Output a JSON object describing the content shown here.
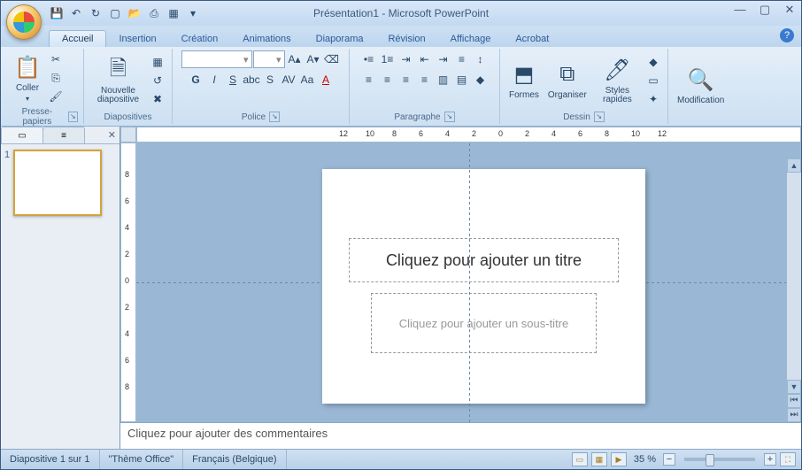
{
  "title": "Présentation1 - Microsoft PowerPoint",
  "tabs": [
    "Accueil",
    "Insertion",
    "Création",
    "Animations",
    "Diaporama",
    "Révision",
    "Affichage",
    "Acrobat"
  ],
  "active_tab": 0,
  "groups": {
    "clipboard": {
      "label": "Presse-papiers",
      "paste": "Coller"
    },
    "slides": {
      "label": "Diapositives",
      "new": "Nouvelle diapositive"
    },
    "font": {
      "label": "Police",
      "name": "",
      "size": ""
    },
    "paragraph": {
      "label": "Paragraphe"
    },
    "drawing": {
      "label": "Dessin",
      "shapes": "Formes",
      "arrange": "Organiser",
      "quick_styles": "Styles rapides"
    },
    "editing": {
      "label": "",
      "find": "Modification"
    }
  },
  "ruler_h": [
    "12",
    "10",
    "8",
    "6",
    "4",
    "2",
    "0",
    "2",
    "4",
    "6",
    "8",
    "10",
    "12"
  ],
  "ruler_v": [
    "8",
    "6",
    "4",
    "2",
    "0",
    "2",
    "4",
    "6",
    "8"
  ],
  "slide": {
    "title_placeholder": "Cliquez pour ajouter un titre",
    "subtitle_placeholder": "Cliquez pour ajouter un sous-titre"
  },
  "notes_placeholder": "Cliquez pour ajouter des commentaires",
  "status": {
    "slide_pos": "Diapositive 1 sur 1",
    "theme": "\"Thème Office\"",
    "language": "Français (Belgique)",
    "zoom": "35 %"
  },
  "thumb_number": "1"
}
